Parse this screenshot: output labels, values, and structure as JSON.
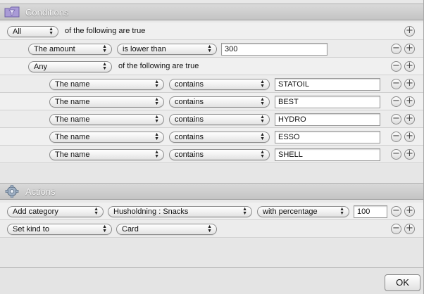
{
  "conditions": {
    "title": "Conditions",
    "match": {
      "value": "All",
      "text": "of the following are true"
    },
    "amount": {
      "field": "The amount",
      "op": "is lower than",
      "value": "300"
    },
    "group": {
      "value": "Any",
      "text": "of the following are true",
      "rules": [
        {
          "field": "The name",
          "op": "contains",
          "value": "STATOIL"
        },
        {
          "field": "The name",
          "op": "contains",
          "value": "BEST"
        },
        {
          "field": "The name",
          "op": "contains",
          "value": "HYDRO"
        },
        {
          "field": "The name",
          "op": "contains",
          "value": "ESSO"
        },
        {
          "field": "The name",
          "op": "contains",
          "value": "SHELL"
        }
      ]
    }
  },
  "actions": {
    "title": "Actions",
    "items": [
      {
        "action": "Add category",
        "target": "Husholdning : Snacks",
        "mode": "with percentage",
        "value": "100"
      },
      {
        "action": "Set kind to",
        "target": "Card"
      }
    ]
  },
  "buttons": {
    "add": "+",
    "remove": "−",
    "ok": "OK",
    "arrows": "▲▼"
  },
  "icons": {
    "conditions": "funnel-folder-icon",
    "actions": "gear-icon"
  }
}
